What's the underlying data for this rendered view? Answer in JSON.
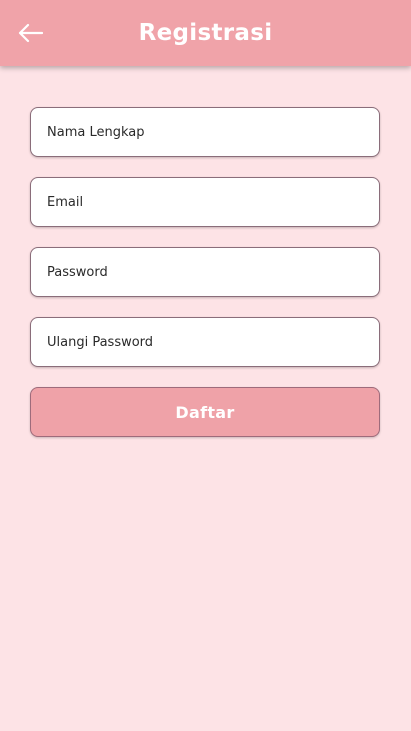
{
  "app_bar": {
    "title": "Registrasi",
    "back_icon": "arrow-left-icon",
    "background_color": "#f0a3a9"
  },
  "form": {
    "fields": [
      {
        "name": "nama-lengkap",
        "placeholder": "Nama Lengkap",
        "value": ""
      },
      {
        "name": "email",
        "placeholder": "Email",
        "value": ""
      },
      {
        "name": "password",
        "placeholder": "Password",
        "value": ""
      },
      {
        "name": "ulangi-password",
        "placeholder": "Ulangi Password",
        "value": ""
      }
    ],
    "submit_label": "Daftar"
  },
  "colors": {
    "page_background": "#fde3e6",
    "button_background": "#efa2a8",
    "text_on_accent": "#ffffff"
  }
}
